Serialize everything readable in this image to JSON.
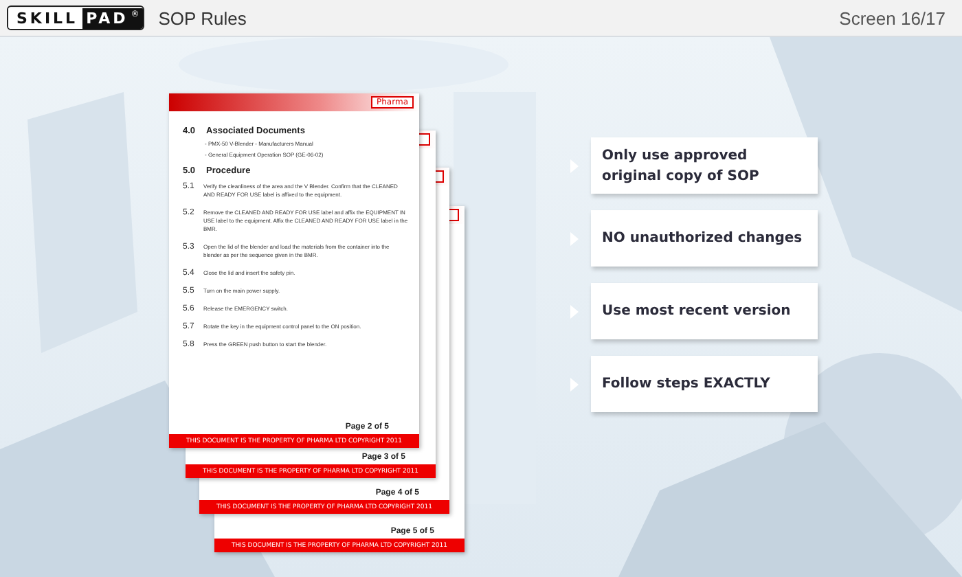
{
  "header": {
    "logo": {
      "left": "SKILL",
      "right": "PAD",
      "mark": "®"
    },
    "title": "SOP Rules",
    "screen": "Screen 16/17"
  },
  "document": {
    "logo": "Pharma",
    "sections": [
      {
        "number": "4.0",
        "title": "Associated Documents",
        "kind": "list",
        "lines": [
          "- PMX-50 V-Blender - Manufacturers Manual",
          "- General Equipment Operation SOP (GE-06-02)"
        ]
      },
      {
        "number": "5.0",
        "title": "Procedure",
        "kind": "steps",
        "steps": [
          {
            "number": "5.1",
            "text": "Verify the cleanliness of the area and the V Blender. Confirm that the CLEANED AND READY FOR USE label is affixed to the equipment."
          },
          {
            "number": "5.2",
            "text": "Remove the CLEANED AND READY FOR USE label and affix the EQUIPMENT IN USE label to the equipment. Affix the CLEANED AND READY FOR USE label in the BMR."
          },
          {
            "number": "5.3",
            "text": "Open the lid of the blender and load the materials from the container into the blender as per the sequence given in the BMR."
          },
          {
            "number": "5.4",
            "text": "Close the lid and insert the safety pin."
          },
          {
            "number": "5.5",
            "text": "Turn on the main power supply."
          },
          {
            "number": "5.6",
            "text": "Release the EMERGENCY switch."
          },
          {
            "number": "5.7",
            "text": "Rotate the key in the equipment control panel to the ON position."
          },
          {
            "number": "5.8",
            "text": "Press the GREEN push button to start the blender."
          }
        ]
      }
    ],
    "pages": [
      {
        "label": "Page 2 of 5",
        "footer": "THIS DOCUMENT IS THE PROPERTY OF PHARMA LTD COPYRIGHT 2011"
      },
      {
        "label": "Page 3 of 5",
        "footer": "THIS DOCUMENT IS THE PROPERTY OF PHARMA LTD COPYRIGHT 2011"
      },
      {
        "label": "Page 4 of 5",
        "footer": "THIS DOCUMENT IS THE PROPERTY OF PHARMA LTD COPYRIGHT 2011"
      },
      {
        "label": "Page 5 of 5",
        "footer": "THIS DOCUMENT IS THE PROPERTY OF PHARMA LTD COPYRIGHT 2011"
      }
    ]
  },
  "rules": [
    "Only use approved original copy of SOP",
    "NO unauthorized changes",
    "Use most recent version",
    "Follow steps EXACTLY"
  ]
}
